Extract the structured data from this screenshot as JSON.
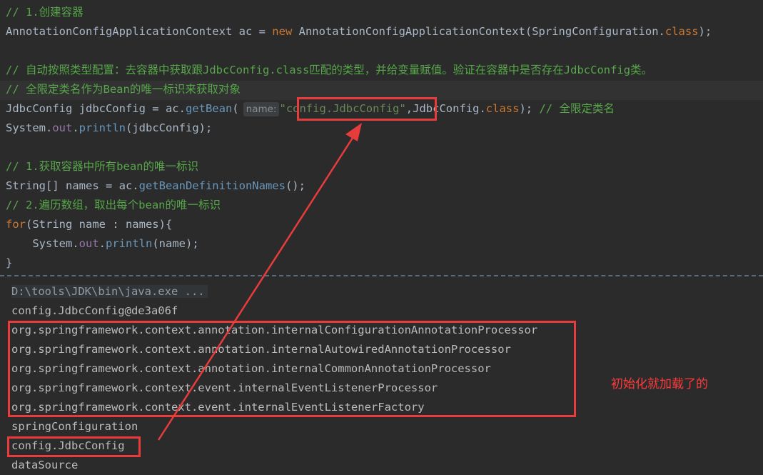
{
  "editor": {
    "line1_comment": "// 1.创建容器",
    "line2": {
      "type": "AnnotationConfigApplicationContext",
      "var": " ac = ",
      "kw_new": "new",
      "ctor": " AnnotationConfigApplicationContext(SpringConfiguration.",
      "kw_class": "class",
      "end": ");"
    },
    "line4_comment": "// 自动按照类型配置：去容器中获取跟JdbcConfig.class匹配的类型，并给变量赋值。验证在容器中是否存在JdbcConfig类。",
    "line5_comment": "// 全限定类名作为Bean的唯一标识来获取对象",
    "line6": {
      "decl": "JdbcConfig jdbcConfig = ac.",
      "method": "getBean",
      "open": "(",
      "hint": "name:",
      "arg": "\"config.JdbcConfig\"",
      "rest": ",JdbcConfig.",
      "kw_class": "class",
      "end": "); ",
      "comment": "// 全限定类名"
    },
    "line7": {
      "obj": "System.",
      "field": "out",
      "dot": ".",
      "method": "println",
      "args": "(jdbcConfig);"
    },
    "line9_comment": "// 1.获取容器中所有bean的唯一标识",
    "line10": {
      "decl": "String[] names = ac.",
      "method": "getBeanDefinitionNames",
      "end": "();"
    },
    "line11_comment": "// 2.遍历数组，取出每个bean的唯一标识",
    "line12": {
      "kw_for": "for",
      "rest": "(String name : names){"
    },
    "line13": {
      "obj": "    System.",
      "field": "out",
      "dot": ".",
      "method": "println",
      "args": "(name);"
    },
    "line14": "}"
  },
  "console": {
    "command": "D:\\tools\\JDK\\bin\\java.exe ...",
    "lines": [
      "config.JdbcConfig@de3a06f",
      "org.springframework.context.annotation.internalConfigurationAnnotationProcessor",
      "org.springframework.context.annotation.internalAutowiredAnnotationProcessor",
      "org.springframework.context.annotation.internalCommonAnnotationProcessor",
      "org.springframework.context.event.internalEventListenerProcessor",
      "org.springframework.context.event.internalEventListenerFactory",
      "springConfiguration",
      "config.JdbcConfig",
      "dataSource"
    ]
  },
  "annotation": {
    "note": "初始化就加载了的",
    "color": "#e83c3c"
  }
}
